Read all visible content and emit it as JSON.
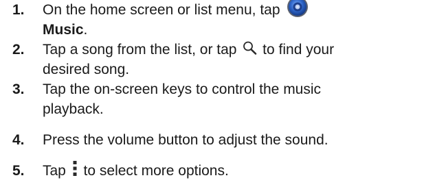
{
  "steps": [
    {
      "number": "1.",
      "text_before_icon": "On the home screen or list menu, tap",
      "icon": "music-app-icon",
      "line2_bold": "Music",
      "line2_tail": "."
    },
    {
      "number": "2.",
      "text_before_icon": "Tap a song from the list, or tap",
      "icon": "search-icon",
      "text_after_icon": "to find your",
      "line2": "desired song."
    },
    {
      "number": "3.",
      "line1": "Tap the on-screen keys to control the music",
      "line2": "playback."
    },
    {
      "number": "4.",
      "text": "Press the volume button to adjust the sound."
    },
    {
      "number": "5.",
      "text_before_icon": "Tap",
      "icon": "menu-dots-icon",
      "text_after_icon": "to select more options."
    }
  ],
  "colors": {
    "text": "#1a1a1a",
    "music_icon_blue": "#2f66c9"
  }
}
